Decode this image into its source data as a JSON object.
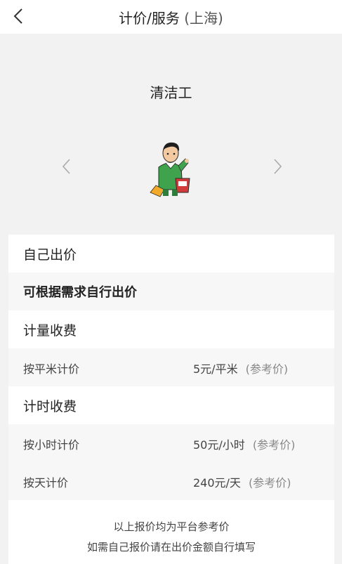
{
  "header": {
    "title": "计价/服务",
    "city": "(上海)"
  },
  "hero": {
    "role_title": "清洁工"
  },
  "sections": {
    "self_price": {
      "heading": "自己出价",
      "desc": "可根据需求自行出价"
    },
    "by_volume": {
      "heading": "计量收费",
      "items": [
        {
          "label": "按平米计价",
          "price": "5元/平米",
          "ref": "(参考价)"
        }
      ]
    },
    "by_time": {
      "heading": "计时收费",
      "items": [
        {
          "label": "按小时计价",
          "price": "50元/小时",
          "ref": "(参考价)"
        },
        {
          "label": "按天计价",
          "price": "240元/天",
          "ref": "(参考价)"
        }
      ]
    }
  },
  "footer": {
    "line1": "以上报价均为平台参考价",
    "line2": "如需自己报价请在出价金额自行填写"
  }
}
